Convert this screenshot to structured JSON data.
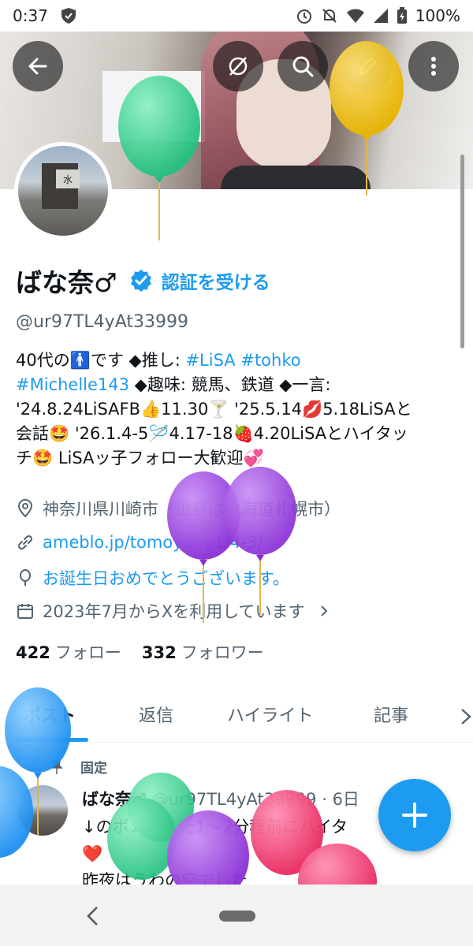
{
  "status_bar": {
    "time": "0:37",
    "battery": "100%"
  },
  "profile": {
    "name": "ばな奈♂",
    "verify_label": "認証を受ける",
    "handle": "@ur97TL4yAt33999",
    "bio_lines": [
      [
        "40代の🚹です ◆推し: ",
        "#LiSA #tohko"
      ],
      [
        "#Michelle143",
        " ◆趣味: 競馬、鉄道 ◆一言:"
      ],
      [
        "'24.8.24LiSAFB👍11.30🍸 '25.5.14💋5.18LiSAと"
      ],
      [
        "会話🤩 '26.1.4-5🪡4.17-18🍓4.20LiSAとハイタッ"
      ],
      [
        "チ🤩 LiSAッ子フォロー大歓迎💞"
      ]
    ],
    "location": "神奈川県川崎市（出身は北海道札幌市）",
    "website": "ameblo.jp/tomoyang1-4-3/",
    "birthday": "お誕生日おめでとうございます。",
    "joined": "2023年7月からXを利用しています",
    "following_count": "422",
    "following_label": "フォロー",
    "followers_count": "332",
    "followers_label": "フォロワー"
  },
  "tabs": [
    "ポスト",
    "返信",
    "ハイライト",
    "記事"
  ],
  "active_tab": "ポスト",
  "pinned_post": {
    "pinned_label": "固定",
    "author": "ばな奈♂",
    "handle": "@ur97TL4yAt33999",
    "time": "· 6日",
    "line1": "↓のポストした1〜2分程前にハイタ",
    "line2": "❤️",
    "line3": "昨夜はうわの空でした"
  },
  "icons": {
    "back": "arrow-left-icon",
    "mute": "slash-circle-icon",
    "search": "search-icon",
    "edit": "pen-icon",
    "more": "more-vertical-icon",
    "verified": "verified-badge-icon",
    "location": "location-pin-icon",
    "link": "link-icon",
    "birthday": "balloon-icon",
    "calendar": "calendar-icon",
    "pin": "pin-icon",
    "compose": "plus-icon"
  },
  "colors": {
    "accent": "#1d9bf0",
    "text": "#0f1419",
    "secondary": "#536471"
  }
}
